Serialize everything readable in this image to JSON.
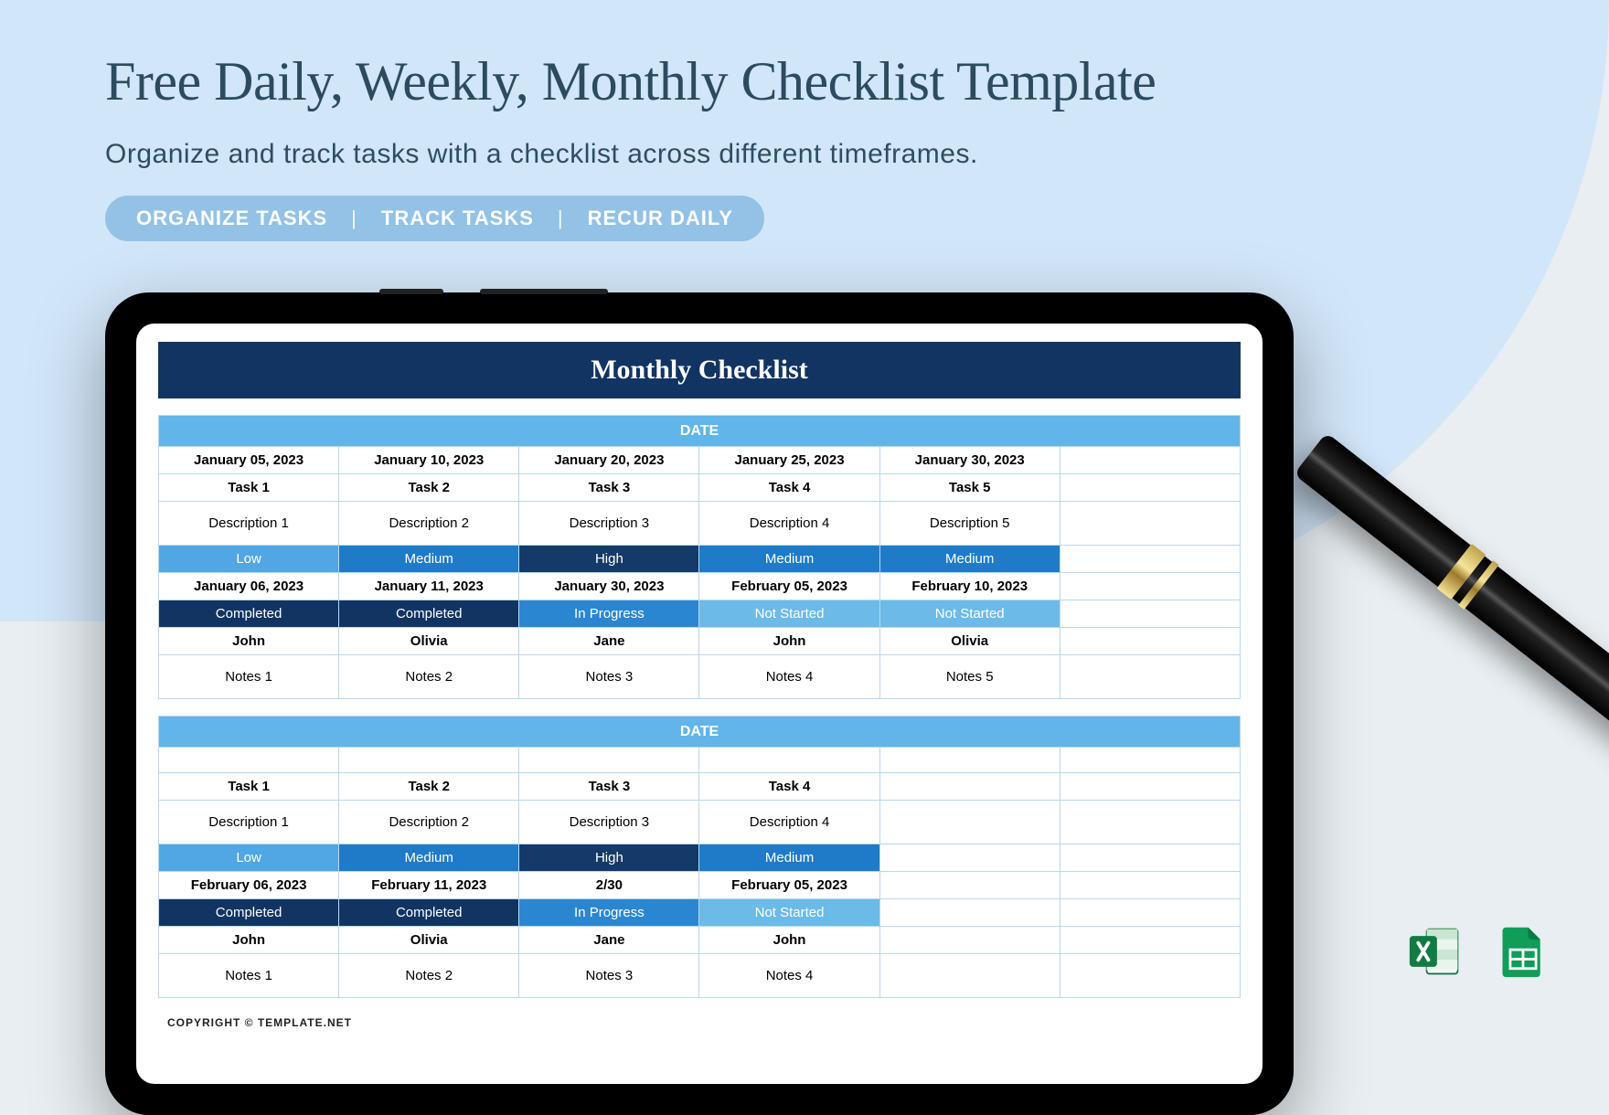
{
  "hero": {
    "title": "Free Daily, Weekly, Monthly Checklist Template",
    "subtitle": "Organize and track tasks with a checklist across different timeframes.",
    "tags": [
      "ORGANIZE TASKS",
      "TRACK TASKS",
      "RECUR DAILY"
    ]
  },
  "spreadsheet": {
    "title": "Monthly Checklist",
    "date_header_label": "DATE",
    "copyright": "COPYRIGHT  ©  TEMPLATE.NET",
    "blocks": [
      {
        "dates": [
          "January 05, 2023",
          "January 10, 2023",
          "January 20, 2023",
          "January 25, 2023",
          "January 30, 2023",
          ""
        ],
        "tasks": [
          "Task 1",
          "Task 2",
          "Task 3",
          "Task 4",
          "Task 5",
          ""
        ],
        "descriptions": [
          "Description 1",
          "Description 2",
          "Description 3",
          "Description 4",
          "Description 5",
          ""
        ],
        "priorities": [
          {
            "label": "Low",
            "level": "low"
          },
          {
            "label": "Medium",
            "level": "med"
          },
          {
            "label": "High",
            "level": "high"
          },
          {
            "label": "Medium",
            "level": "med"
          },
          {
            "label": "Medium",
            "level": "med"
          },
          {
            "label": "",
            "level": ""
          }
        ],
        "due": [
          "January 06, 2023",
          "January 11, 2023",
          "January 30, 2023",
          "February 05, 2023",
          "February 10, 2023",
          ""
        ],
        "statuses": [
          {
            "label": "Completed",
            "level": "completed"
          },
          {
            "label": "Completed",
            "level": "completed"
          },
          {
            "label": "In Progress",
            "level": "in_progress"
          },
          {
            "label": "Not Started",
            "level": "not_started"
          },
          {
            "label": "Not Started",
            "level": "not_started"
          },
          {
            "label": "",
            "level": ""
          }
        ],
        "owners": [
          "John",
          "Olivia",
          "Jane",
          "John",
          "Olivia",
          ""
        ],
        "notes": [
          "Notes 1",
          "Notes 2",
          "Notes 3",
          "Notes 4",
          "Notes 5",
          ""
        ]
      },
      {
        "dates": [
          "",
          "",
          "",
          "",
          "",
          ""
        ],
        "tasks": [
          "Task 1",
          "Task 2",
          "Task 3",
          "Task 4",
          "",
          ""
        ],
        "descriptions": [
          "Description 1",
          "Description 2",
          "Description 3",
          "Description 4",
          "",
          ""
        ],
        "priorities": [
          {
            "label": "Low",
            "level": "low"
          },
          {
            "label": "Medium",
            "level": "med"
          },
          {
            "label": "High",
            "level": "high"
          },
          {
            "label": "Medium",
            "level": "med"
          },
          {
            "label": "",
            "level": ""
          },
          {
            "label": "",
            "level": ""
          }
        ],
        "due": [
          "February 06, 2023",
          "February 11, 2023",
          "2/30",
          "February 05, 2023",
          "",
          ""
        ],
        "statuses": [
          {
            "label": "Completed",
            "level": "completed"
          },
          {
            "label": "Completed",
            "level": "completed"
          },
          {
            "label": "In Progress",
            "level": "in_progress"
          },
          {
            "label": "Not Started",
            "level": "not_started"
          },
          {
            "label": "",
            "level": ""
          },
          {
            "label": "",
            "level": ""
          }
        ],
        "owners": [
          "John",
          "Olivia",
          "Jane",
          "John",
          "",
          ""
        ],
        "notes": [
          "Notes 1",
          "Notes 2",
          "Notes 3",
          "Notes 4",
          "",
          ""
        ]
      }
    ]
  },
  "icons": {
    "excel": "excel-icon",
    "sheets": "google-sheets-icon"
  }
}
